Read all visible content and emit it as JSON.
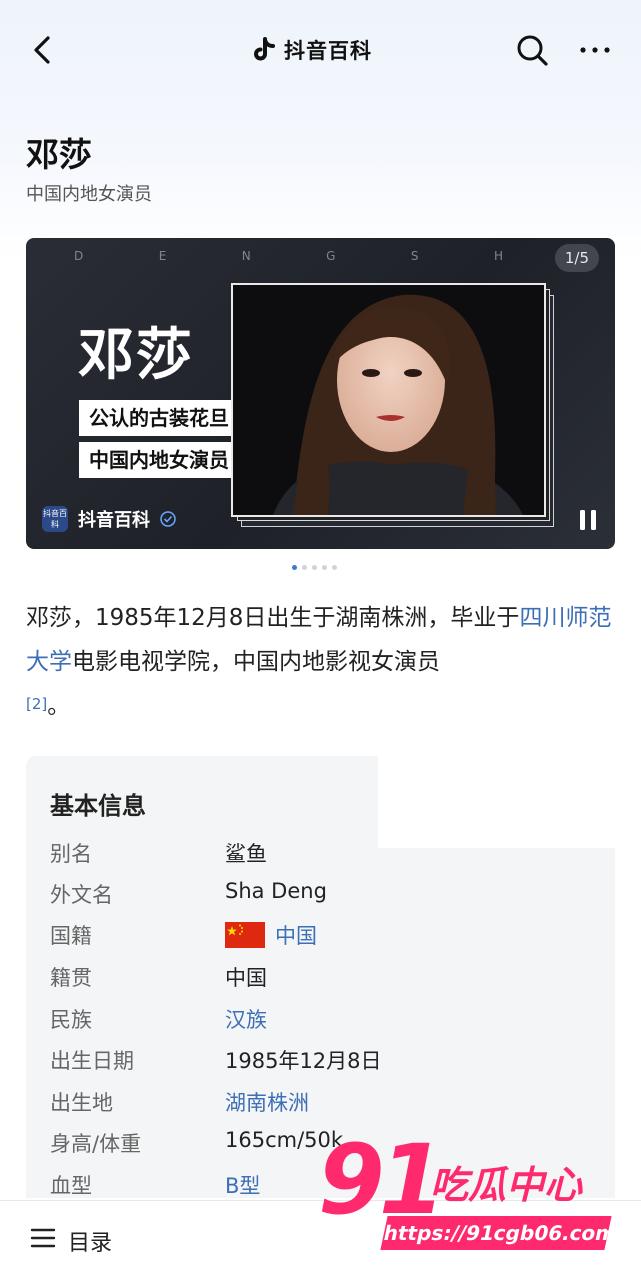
{
  "header": {
    "brand": "抖音百科"
  },
  "page": {
    "title": "邓莎",
    "subtitle": "中国内地女演员"
  },
  "banner": {
    "letters": [
      "D",
      "E",
      "N",
      "G",
      "S",
      "H"
    ],
    "counter": "1/5",
    "name": "邓莎",
    "tag1": "公认的古装花旦",
    "tag2": "中国内地女演员",
    "source": "抖音百科",
    "logo_text": "抖音百科"
  },
  "intro": {
    "part1": "邓莎，1985年12月8日出生于湖南株洲，毕业于",
    "link": "四川师范大学",
    "part2": "电影电视学院，中国内地影视女演员",
    "ref": "[2]",
    "end": "。"
  },
  "info": {
    "title": "基本信息",
    "rows": [
      {
        "k": "别名",
        "v": "鲨鱼"
      },
      {
        "k": "外文名",
        "v": "Sha Deng"
      },
      {
        "k": "国籍",
        "v": "中国"
      },
      {
        "k": "籍贯",
        "v": "中国"
      },
      {
        "k": "民族",
        "v": "汉族"
      },
      {
        "k": "出生日期",
        "v": "1985年12月8日"
      },
      {
        "k": "出生地",
        "v": "湖南株洲"
      },
      {
        "k": "身高/体重",
        "v": "165cm/50k"
      },
      {
        "k": "血型",
        "v": "B型"
      }
    ]
  },
  "bottom": {
    "toc": "目录"
  },
  "watermark": {
    "num": "91",
    "cn": "吃瓜中心",
    "url": "https://91cgb06.com"
  },
  "colors": {
    "link": "#3c6fb5",
    "watermark": "#ff2a6d",
    "banner_bg": "#23262d"
  }
}
